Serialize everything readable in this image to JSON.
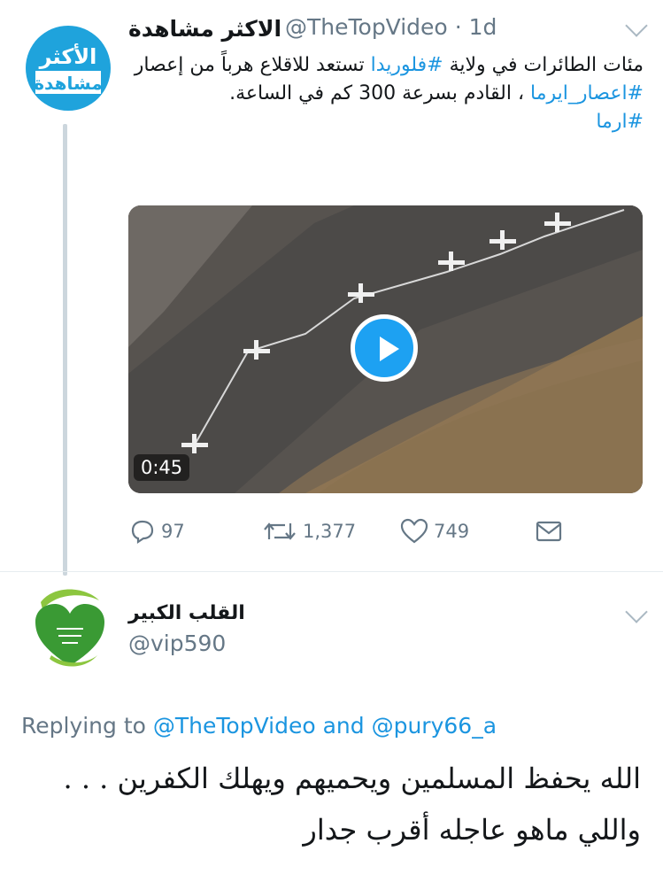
{
  "tweet": {
    "avatar_text_line1": "الأكثر",
    "avatar_text_line2": "مشاهدة",
    "display_name": "الاكثر مشاهدة",
    "handle": "@TheTopVideo",
    "time": "· 1d",
    "text_part1": "مئات الطائرات في ولاية ",
    "tag1": "#فلوريدا",
    "text_part2": " تستعد للاقلاع  هرباً من إعصار ",
    "tag2": "#اعصار_ايرما",
    "text_part3": " ، القادم بسرعة 300 كم في الساعة.",
    "tag3": "#ارما",
    "video_duration": "0:45",
    "actions": {
      "replies": "97",
      "retweets": "1,377",
      "likes": "749"
    },
    "icons": [
      "reply-icon",
      "retweet-icon",
      "like-icon",
      "message-icon",
      "chevron-down-icon",
      "play-icon"
    ]
  },
  "reply": {
    "display_name": "القلب الكبير",
    "handle": "@vip590",
    "replying_label": "Replying to",
    "replying_user1": "@TheTopVideo",
    "replying_and": "and",
    "replying_user2": "@pury66_a",
    "text_line1": "الله يحفظ المسلمين ويحميهم ويهلك الكفرين . . .",
    "text_line2": "واللي ماهو عاجله أقرب جدار"
  },
  "colors": {
    "accent": "#1da1f2",
    "link": "#1b95e0",
    "muted": "#657786",
    "avatar_blue": "#1fa3dc",
    "avatar_green": "#3a9a34"
  }
}
